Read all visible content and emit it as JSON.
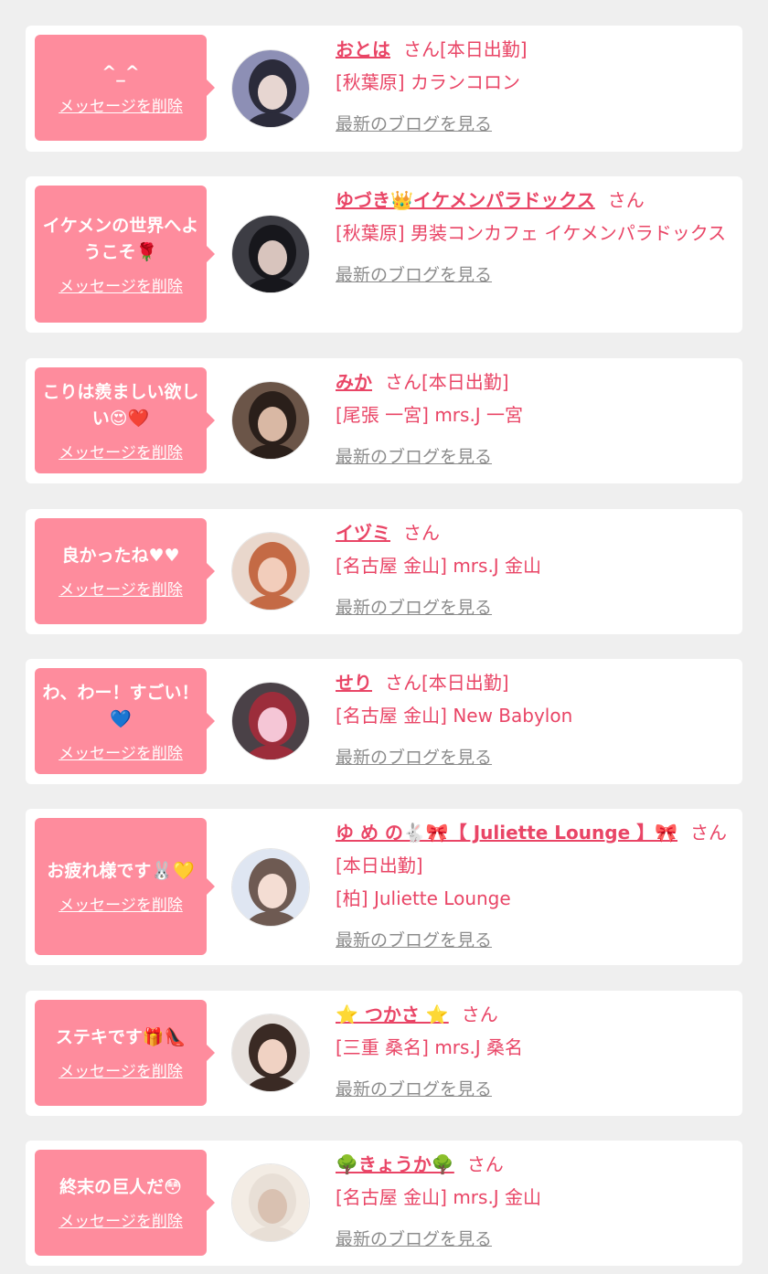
{
  "cards": [
    {
      "message": "^_^",
      "delete_label": "メッセージを削除",
      "name": "おとは",
      "suffix": "さん[本日出勤]",
      "shop": "[秋葉原] カランコロン",
      "blog_label": "最新のブログを見る",
      "avatar_colors": [
        "#8d8fb5",
        "#2b2b3a",
        "#e7d6d1"
      ]
    },
    {
      "message": "イケメンの世界へようこそ🌹",
      "delete_label": "メッセージを削除",
      "name": "ゆづき👑イケメンパラドックス",
      "suffix": "さん",
      "shop": "[秋葉原] 男装コンカフェ イケメンパラドックス",
      "blog_label": "最新のブログを見る",
      "avatar_colors": [
        "#3d3d44",
        "#17171c",
        "#d8c4bd"
      ]
    },
    {
      "message": "こりは羨ましい欲しい😍❤️",
      "delete_label": "メッセージを削除",
      "name": "みか",
      "suffix": "さん[本日出勤]",
      "shop": "[尾張 一宮] mrs.J 一宮",
      "blog_label": "最新のブログを見る",
      "avatar_colors": [
        "#6b5548",
        "#2a1f1a",
        "#d9b8a4"
      ]
    },
    {
      "message": "良かったね♥♥",
      "delete_label": "メッセージを削除",
      "name": "イヅミ",
      "suffix": "さん",
      "shop": "[名古屋 金山] mrs.J 金山",
      "blog_label": "最新のブログを見る",
      "avatar_colors": [
        "#e9d7cc",
        "#c46a45",
        "#f2cdbb"
      ]
    },
    {
      "message": "わ、わー！すごい！💙",
      "delete_label": "メッセージを削除",
      "name": "せり",
      "suffix": "さん[本日出勤]",
      "shop": "[名古屋 金山] New Babylon",
      "blog_label": "最新のブログを見る",
      "avatar_colors": [
        "#4a4147",
        "#9c2d3b",
        "#f5c6d6"
      ]
    },
    {
      "message": "お疲れ様です🐰💛",
      "delete_label": "メッセージを削除",
      "name": "ゆ め の🐇🎀【 Juliette Lounge 】🎀",
      "suffix": "さん[本日出勤]",
      "shop": "[柏] Juliette Lounge",
      "blog_label": "最新のブログを見る",
      "avatar_colors": [
        "#dfe6f2",
        "#6e5a52",
        "#f4ddd3"
      ]
    },
    {
      "message": "ステキです🎁👠",
      "delete_label": "メッセージを削除",
      "name": "⭐ つかさ ⭐",
      "suffix": "さん",
      "shop": "[三重 桑名] mrs.J 桑名",
      "blog_label": "最新のブログを見る",
      "avatar_colors": [
        "#e6e0dc",
        "#3a2a24",
        "#f0d2c3"
      ]
    },
    {
      "message": "終末の巨人だ😳",
      "delete_label": "メッセージを削除",
      "name": "🌳きょうか🌳",
      "suffix": "さん",
      "shop": "[名古屋 金山] mrs.J 金山",
      "blog_label": "最新のブログを見る",
      "avatar_colors": [
        "#f3ece4",
        "#e8dfd6",
        "#d9c1b1"
      ]
    }
  ]
}
